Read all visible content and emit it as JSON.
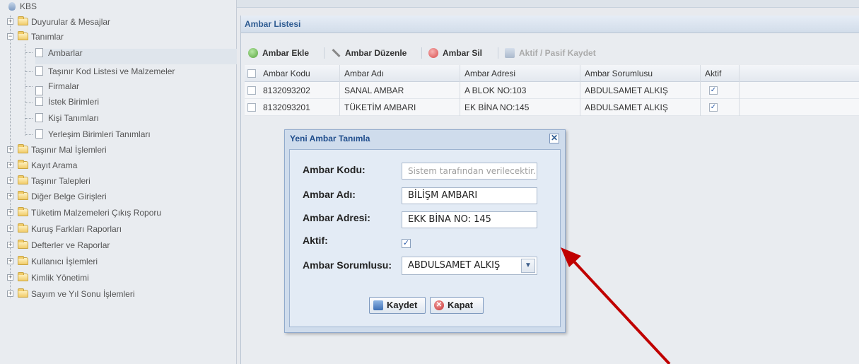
{
  "tree": {
    "root": "KBS",
    "items": [
      {
        "label": "Duyurular & Mesajlar"
      },
      {
        "label": "Tanımlar"
      },
      {
        "label": "Ambarlar"
      },
      {
        "label": "Taşınır Kod Listesi ve Malzemeler"
      },
      {
        "label": "Firmalar"
      },
      {
        "label": "İstek Birimleri"
      },
      {
        "label": "Kişi Tanımları"
      },
      {
        "label": "Yerleşim Birimleri Tanımları"
      },
      {
        "label": "Taşınır Mal İşlemleri"
      },
      {
        "label": "Kayıt Arama"
      },
      {
        "label": "Taşınır Talepleri"
      },
      {
        "label": "Diğer Belge Girişleri"
      },
      {
        "label": "Tüketim Malzemeleri Çıkış Roporu"
      },
      {
        "label": "Kuruş Farkları Raporları"
      },
      {
        "label": "Defterler ve Raporlar"
      },
      {
        "label": "Kullanıcı İşlemleri"
      },
      {
        "label": "Kimlik Yönetimi"
      },
      {
        "label": "Sayım ve Yıl Sonu İşlemleri"
      }
    ]
  },
  "panel": {
    "title": "Ambar Listesi",
    "toolbar": {
      "add": "Ambar Ekle",
      "edit": "Ambar Düzenle",
      "delete": "Ambar Sil",
      "save_active": "Aktif / Pasif Kaydet"
    },
    "grid": {
      "columns": [
        "Ambar Kodu",
        "Ambar Adı",
        "Ambar Adresi",
        "Ambar Sorumlusu",
        "Aktif"
      ],
      "rows": [
        {
          "kod": "8132093202",
          "adi": "SANAL AMBAR",
          "adres": "A BLOK NO:103",
          "sorumlu": "ABDULSAMET ALKIŞ",
          "aktif": true
        },
        {
          "kod": "8132093201",
          "adi": "TÜKETİM AMBARI",
          "adres": "EK BİNA NO:145",
          "sorumlu": "ABDULSAMET ALKIŞ",
          "aktif": true
        }
      ]
    }
  },
  "modal": {
    "title": "Yeni Ambar Tanımla",
    "close_glyph": "✕",
    "fields": {
      "kod_label": "Ambar Kodu:",
      "kod_placeholder": "Sistem tarafından verilecektir.",
      "adi_label": "Ambar Adı:",
      "adi_value": "BİLİŞM AMBARI",
      "adres_label": "Ambar Adresi:",
      "adres_value": "EKK BİNA NO: 145",
      "aktif_label": "Aktif:",
      "aktif_checked": true,
      "sorumlu_label": "Ambar Sorumlusu:",
      "sorumlu_value": "ABDULSAMET ALKIŞ"
    },
    "buttons": {
      "save": "Kaydet",
      "close": "Kapat"
    }
  },
  "colors": {
    "annotation_arrow": "#c00000",
    "title_blue": "#2e5b91"
  },
  "icons": [
    "plus-circle-icon",
    "pencil-icon",
    "minus-circle-icon",
    "save-icon",
    "close-icon",
    "folder-icon",
    "page-icon",
    "dropdown-arrow-icon"
  ]
}
